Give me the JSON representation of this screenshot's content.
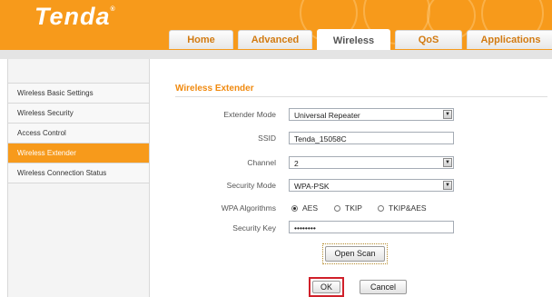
{
  "brand": {
    "logo_text": "Tenda",
    "reg_mark": "®"
  },
  "nav": {
    "tabs": [
      {
        "label": "Home",
        "active": false
      },
      {
        "label": "Advanced",
        "active": false
      },
      {
        "label": "Wireless",
        "active": true
      },
      {
        "label": "QoS",
        "active": false
      },
      {
        "label": "Applications",
        "active": false
      }
    ]
  },
  "sidebar": {
    "items": [
      {
        "label": "Wireless Basic Settings",
        "active": false
      },
      {
        "label": "Wireless Security",
        "active": false
      },
      {
        "label": "Access Control",
        "active": false
      },
      {
        "label": "Wireless Extender",
        "active": true
      },
      {
        "label": "Wireless Connection Status",
        "active": false
      }
    ]
  },
  "form": {
    "title": "Wireless Extender",
    "extender_mode": {
      "label": "Extender Mode",
      "value": "Universal Repeater"
    },
    "ssid": {
      "label": "SSID",
      "value": "Tenda_15058C"
    },
    "channel": {
      "label": "Channel",
      "value": "2"
    },
    "security_mode": {
      "label": "Security Mode",
      "value": "WPA-PSK"
    },
    "wpa_algorithms": {
      "label": "WPA Algorithms",
      "options": [
        "AES",
        "TKIP",
        "TKIP&AES"
      ],
      "selected": "AES"
    },
    "security_key": {
      "label": "Security Key",
      "value": "••••••••"
    }
  },
  "buttons": {
    "open_scan": "Open Scan",
    "ok": "OK",
    "cancel": "Cancel"
  },
  "colors": {
    "brand_orange": "#f79a1b",
    "title_orange": "#f08a10",
    "highlight_red": "#d0202a"
  }
}
